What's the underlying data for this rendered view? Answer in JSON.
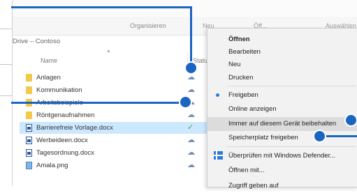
{
  "toolbar": {
    "organize": "Organisieren",
    "new": "Neu",
    "open": "Öff...",
    "select": "Auswählen"
  },
  "address": "Drive – Contoso",
  "columns": {
    "name": "Name",
    "status": "Statu"
  },
  "files": [
    {
      "name": "Anlagen",
      "type": "folder",
      "status": "cloud"
    },
    {
      "name": "Kommunikation",
      "type": "folder",
      "status": "cloud"
    },
    {
      "name": "Arbeitsbeispiele",
      "type": "folder",
      "status": "cloud"
    },
    {
      "name": "Röntgenaufnahmen",
      "type": "folder",
      "status": "cloud"
    },
    {
      "name": "Barrierefreie Vorlage.docx",
      "type": "docx",
      "status": "synced",
      "selected": true
    },
    {
      "name": "Werbeideen.docx",
      "type": "docx",
      "status": "cloud"
    },
    {
      "name": "Tagesordnung.docx",
      "type": "docx",
      "status": "cloud"
    },
    {
      "name": "Amala.png",
      "type": "image",
      "status": "cloud"
    }
  ],
  "context_menu": {
    "open": "Öffnen",
    "edit": "Bearbeiten",
    "new": "Neu",
    "print": "Drucken",
    "share": "Freigeben",
    "view_online": "Online anzeigen",
    "keep_on_device": "Immer auf diesem Gerät beibehalten",
    "free_up_space": "Speicherplatz freigeben",
    "defender": "Überprüfen mit Windows Defender...",
    "open_with": "Öffnen mit...",
    "give_access": "Zugriff geben auf"
  },
  "colors": {
    "callout": "#1a64c2",
    "selected_row": "#cce8ff",
    "menu_bg": "#f2f2f2"
  },
  "icons": {
    "cloud": "cloud-icon",
    "synced": "check-circle-icon",
    "folder": "folder-icon",
    "docx": "word-document-icon",
    "image": "image-file-icon",
    "share": "share-dot-icon",
    "defender": "windows-defender-icon"
  }
}
